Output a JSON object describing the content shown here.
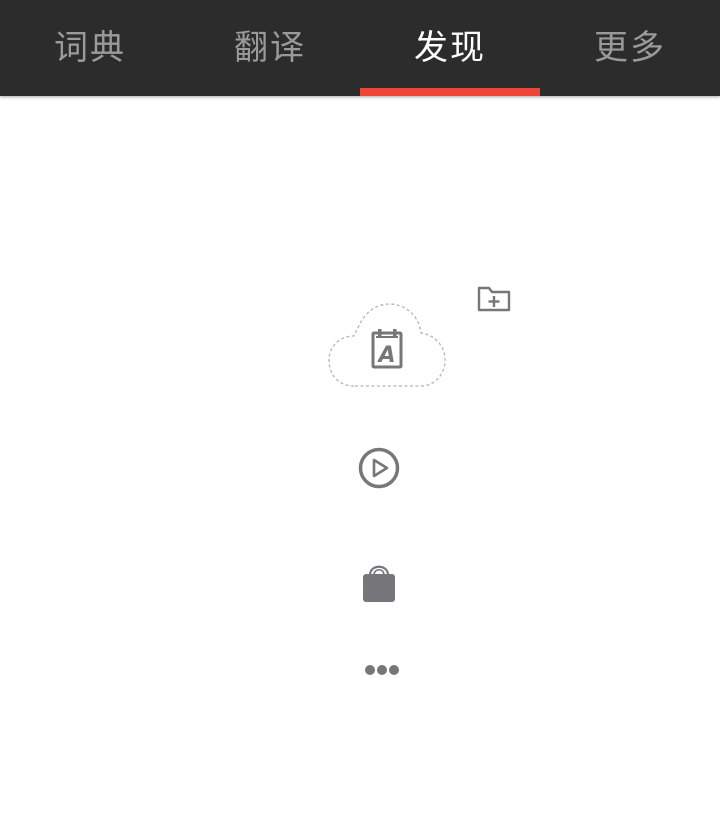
{
  "tabs": [
    {
      "label": "词典",
      "active": false
    },
    {
      "label": "翻译",
      "active": false
    },
    {
      "label": "发现",
      "active": true
    },
    {
      "label": "更多",
      "active": false
    }
  ],
  "colors": {
    "tabbar_bg": "#2c2c2c",
    "tab_inactive": "#9a9a9a",
    "tab_active": "#ffffff",
    "indicator": "#ee4538",
    "icon_gray": "#77767b"
  },
  "icons": {
    "wordbook_cloud": "cloud-notebook-icon",
    "new_folder": "folder-plus-icon",
    "video": "play-circle-icon",
    "shop": "shopping-bag-icon",
    "more": "more-dots-icon"
  }
}
